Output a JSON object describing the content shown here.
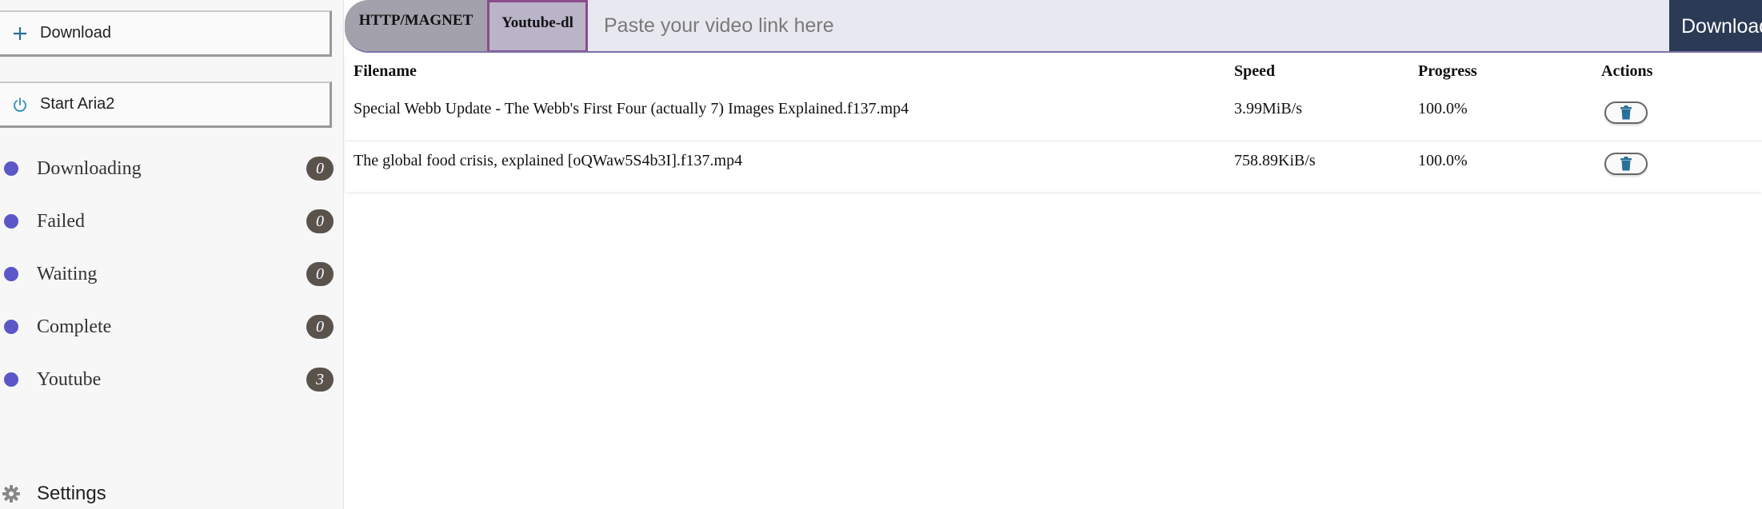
{
  "sidebar": {
    "download_button": {
      "label": "Download",
      "icon": "plus-icon"
    },
    "aria_button": {
      "label": "Start Aria2",
      "icon": "power-icon"
    },
    "items": [
      {
        "label": "Downloading",
        "count": "0"
      },
      {
        "label": "Failed",
        "count": "0"
      },
      {
        "label": "Waiting",
        "count": "0"
      },
      {
        "label": "Complete",
        "count": "0"
      },
      {
        "label": "Youtube",
        "count": "3"
      }
    ],
    "settings_label": "Settings",
    "dot_color": "#5b57c6"
  },
  "topbar": {
    "tab_http": "HTTP/MAGNET",
    "tab_ytdl": "Youtube-dl",
    "url_placeholder": "Paste your video link here",
    "url_value": "",
    "download_label": "Download"
  },
  "table": {
    "headers": {
      "filename": "Filename",
      "speed": "Speed",
      "progress": "Progress",
      "actions": "Actions"
    },
    "rows": [
      {
        "filename": "Special Webb Update - The Webb's First Four (actually 7) Images Explained.f137.mp4",
        "speed": "3.99MiB/s",
        "progress": "100.0%"
      },
      {
        "filename": "The global food crisis, explained [oQWaw5S4b3I].f137.mp4",
        "speed": "758.89KiB/s",
        "progress": "100.0%"
      }
    ]
  },
  "colors": {
    "accent_dark": "#2b3a55",
    "badge": "#5a534c",
    "trash_icon": "#2a6f97"
  }
}
